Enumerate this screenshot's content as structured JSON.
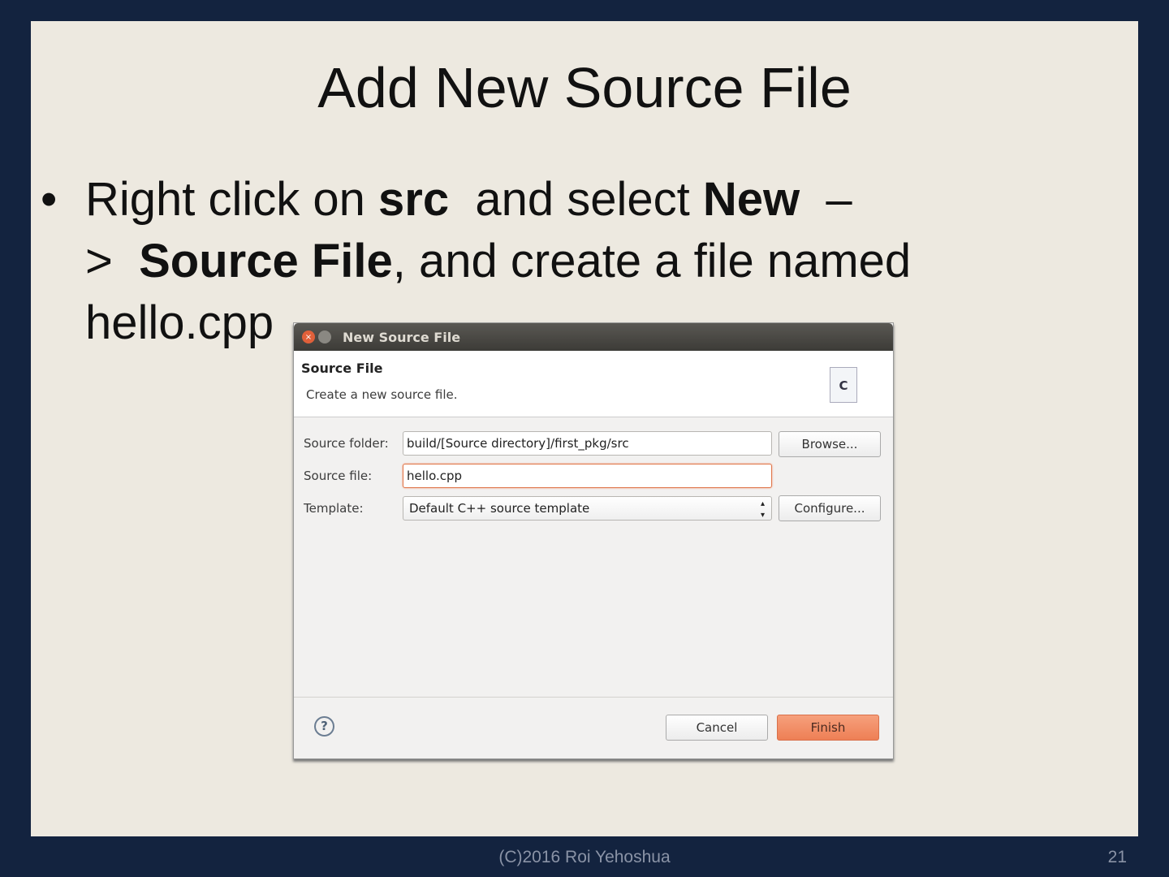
{
  "slide": {
    "title": "Add New Source File",
    "bullet": "•",
    "line1": {
      "a": "Right click on ",
      "b": "src",
      "c": "  and select ",
      "d": "New",
      "e": "  –"
    },
    "line2": {
      "a": ">  ",
      "b": "Source File",
      "c": ", and create a file named"
    },
    "line3": "hello.cpp",
    "footer": "(C)2016 Roi Yehoshua",
    "page": "21"
  },
  "dialog": {
    "title": "New Source File",
    "header": "Source File",
    "description": "Create a new source file.",
    "icon_letter": "C",
    "source_folder_label": "Source folder:",
    "source_folder_value": "build/[Source directory]/first_pkg/src",
    "source_file_label": "Source file:",
    "source_file_value": "hello.cpp",
    "template_label": "Template:",
    "template_value": "Default C++ source template",
    "browse": "Browse...",
    "configure": "Configure...",
    "cancel": "Cancel",
    "finish": "Finish",
    "help": "?"
  }
}
